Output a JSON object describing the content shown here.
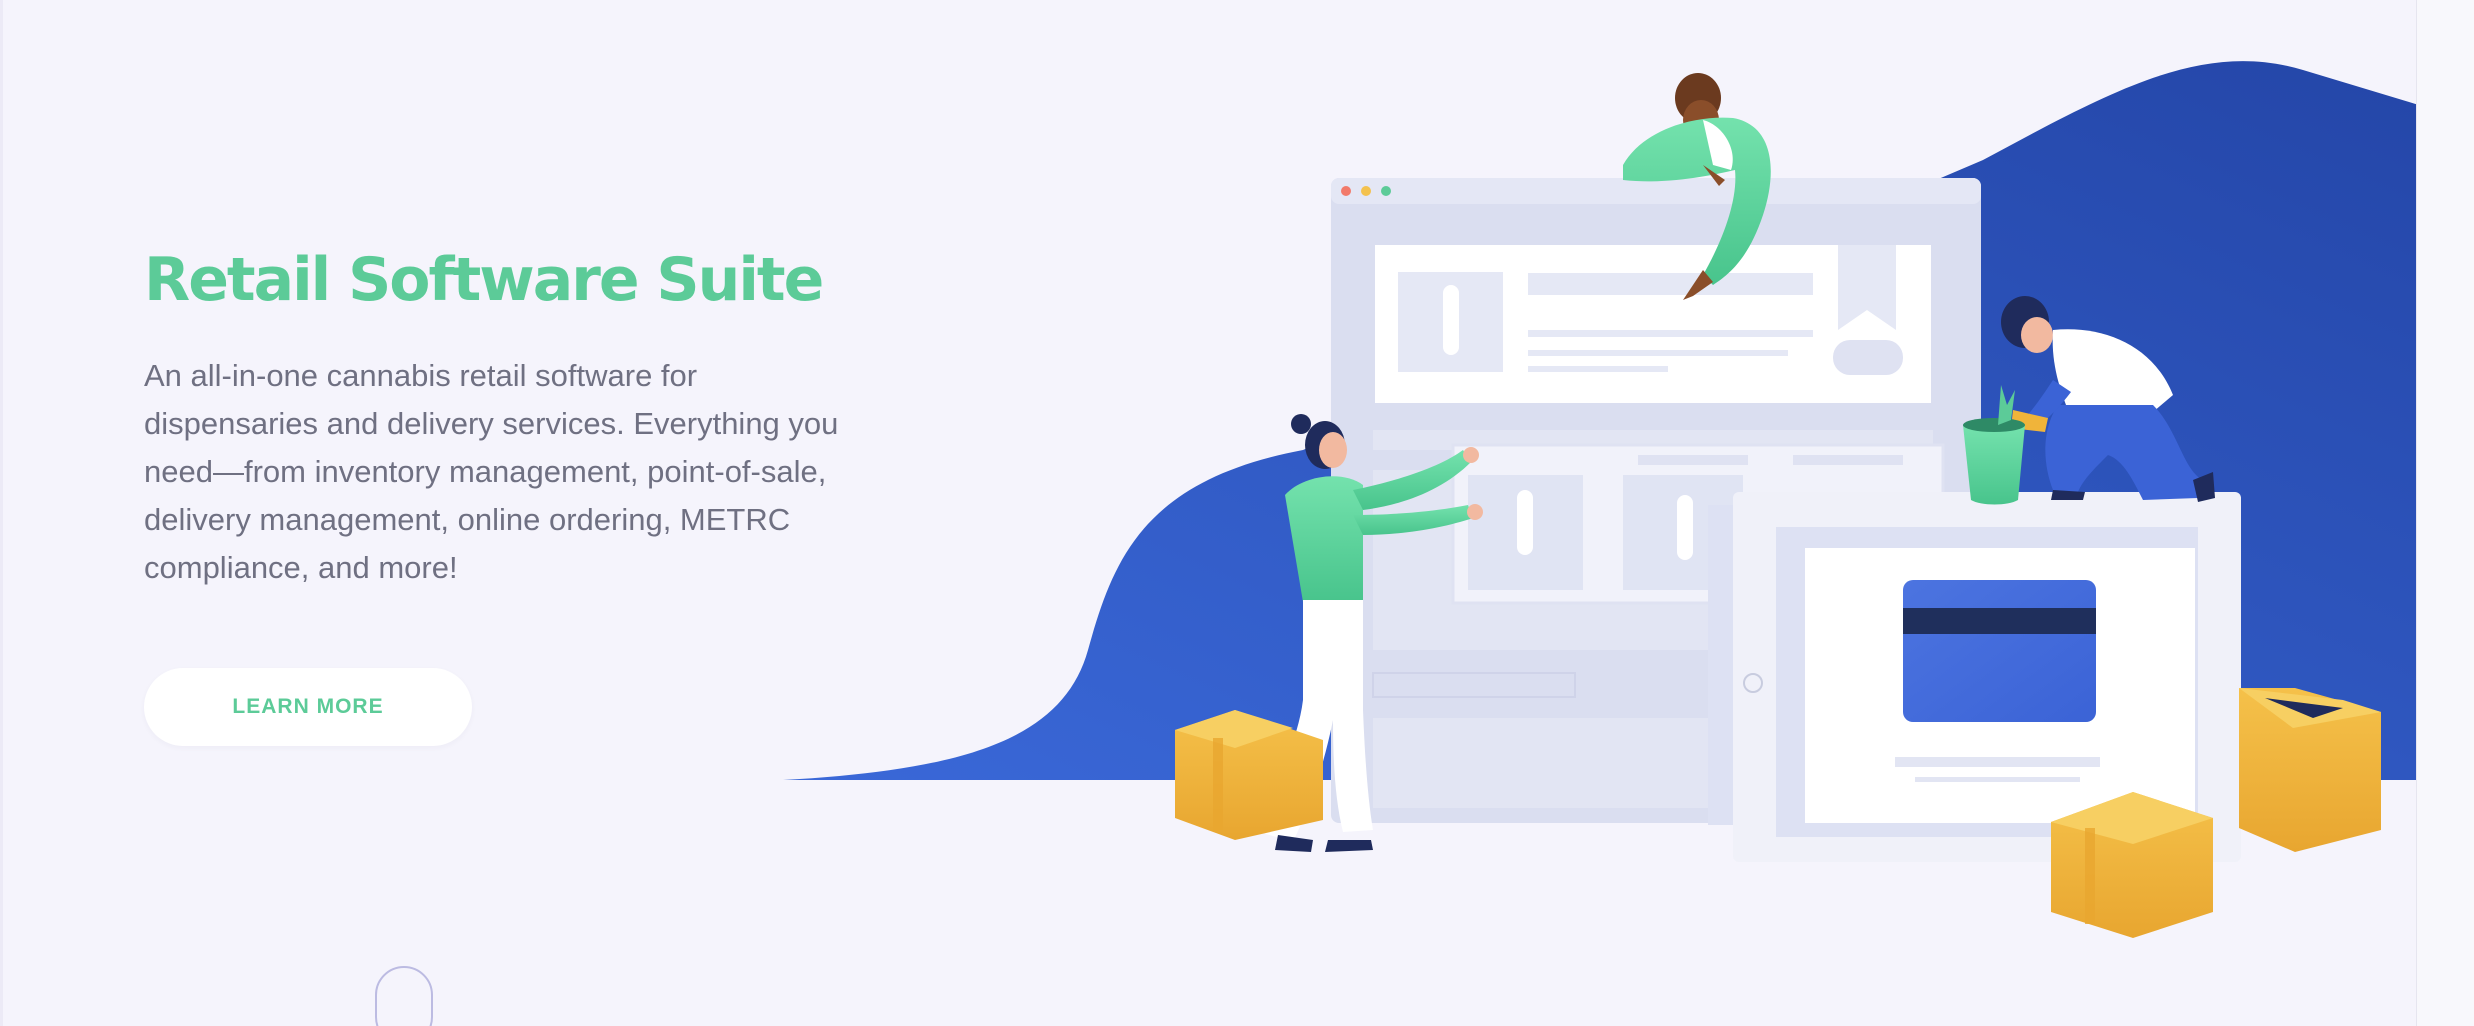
{
  "hero": {
    "title": "Retail Software Suite",
    "description": "An all-in-one cannabis retail software for dispensaries and delivery services. Everything you need—from inventory management, point-of-sale, delivery management, online ordering, METRC compliance, and more!",
    "cta_label": "LEARN MORE"
  },
  "colors": {
    "accent_green": "#5ccb98",
    "brand_blue": "#2f53c4",
    "background": "#f5f4fc",
    "body_text": "#6f7082",
    "box_yellow": "#f0b43a"
  },
  "illustration": {
    "icons": [
      "browser-window-illustration",
      "person-leaning-illustration",
      "woman-holding-card-illustration",
      "man-planting-illustration",
      "pos-terminal-illustration",
      "credit-card-icon",
      "cardboard-box-icon",
      "plant-pot-icon"
    ]
  }
}
